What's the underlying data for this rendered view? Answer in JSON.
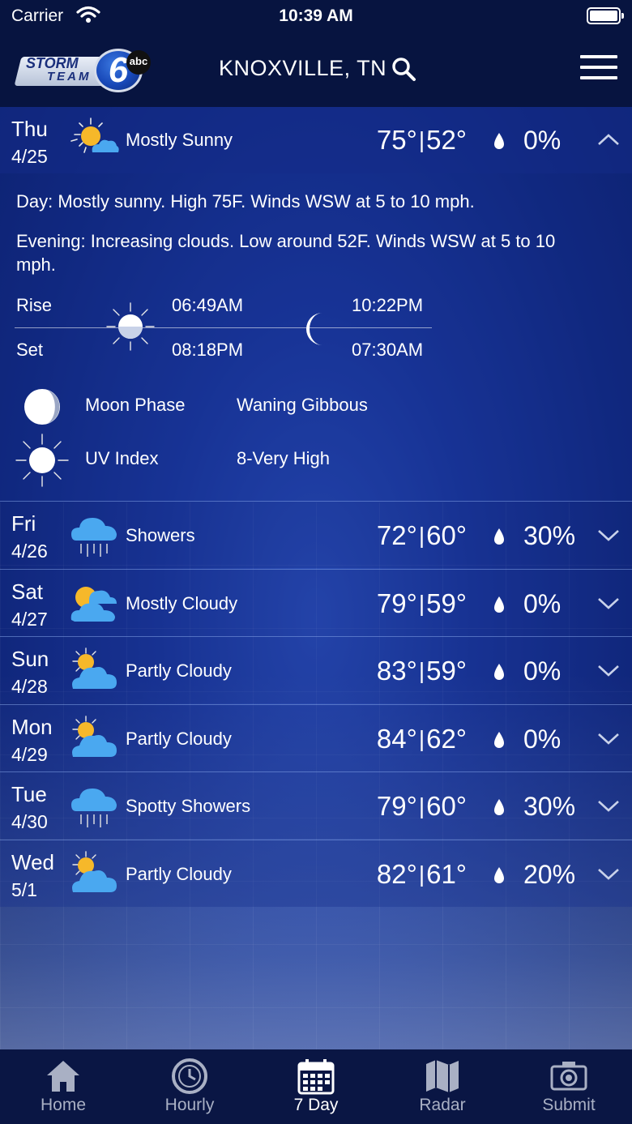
{
  "status_bar": {
    "carrier": "Carrier",
    "time": "10:39 AM"
  },
  "header": {
    "logo": {
      "line1": "STORM",
      "line2": "TEAM",
      "number": "6",
      "network": "abc"
    },
    "location": "KNOXVILLE, TN"
  },
  "expanded_day": {
    "dow": "Thu",
    "date": "4/25",
    "condition": "Mostly Sunny",
    "icon": "sun-cloud-icon",
    "high": "75°",
    "low": "52°",
    "temp_sep": "|",
    "precip": "0%",
    "day_label": "Day",
    "day_text": ": Mostly sunny. High 75F. Winds WSW at 5 to 10 mph.",
    "evening_label": "Evening",
    "evening_text": ": Increasing clouds. Low around 52F. Winds WSW at 5 to 10 mph.",
    "rise_label": "Rise",
    "set_label": "Set",
    "sunrise": "06:49AM",
    "sunset": "08:18PM",
    "moonrise": "10:22PM",
    "moonset": "07:30AM",
    "moon_phase_label": "Moon Phase",
    "moon_phase_value": "Waning Gibbous",
    "uv_label": "UV Index",
    "uv_value": "8-Very High"
  },
  "forecast": [
    {
      "dow": "Fri",
      "date": "4/26",
      "condition": "Showers",
      "icon": "rain-cloud-icon",
      "high": "72°",
      "low": "60°",
      "precip": "30%"
    },
    {
      "dow": "Sat",
      "date": "4/27",
      "condition": "Mostly Cloudy",
      "icon": "cloud-sun-icon",
      "high": "79°",
      "low": "59°",
      "precip": "0%"
    },
    {
      "dow": "Sun",
      "date": "4/28",
      "condition": "Partly Cloudy",
      "icon": "partly-cloudy-icon",
      "high": "83°",
      "low": "59°",
      "precip": "0%"
    },
    {
      "dow": "Mon",
      "date": "4/29",
      "condition": "Partly Cloudy",
      "icon": "partly-cloudy-icon",
      "high": "84°",
      "low": "62°",
      "precip": "0%"
    },
    {
      "dow": "Tue",
      "date": "4/30",
      "condition": "Spotty Showers",
      "icon": "rain-cloud-icon",
      "high": "79°",
      "low": "60°",
      "precip": "30%"
    },
    {
      "dow": "Wed",
      "date": "5/1",
      "condition": "Partly Cloudy",
      "icon": "partly-cloudy-icon",
      "high": "82°",
      "low": "61°",
      "precip": "20%"
    }
  ],
  "tabs": [
    {
      "label": "Home",
      "icon": "home-icon",
      "active": false
    },
    {
      "label": "Hourly",
      "icon": "clock-icon",
      "active": false
    },
    {
      "label": "7 Day",
      "icon": "calendar-icon",
      "active": true
    },
    {
      "label": "Radar",
      "icon": "map-icon",
      "active": false
    },
    {
      "label": "Submit",
      "icon": "camera-icon",
      "active": false
    }
  ],
  "colors": {
    "header_bg": "#071440",
    "tab_inactive": "#a9b0c4",
    "tab_active": "#ffffff",
    "sun": "#f6b82a",
    "cloud": "#4aa8f0"
  }
}
